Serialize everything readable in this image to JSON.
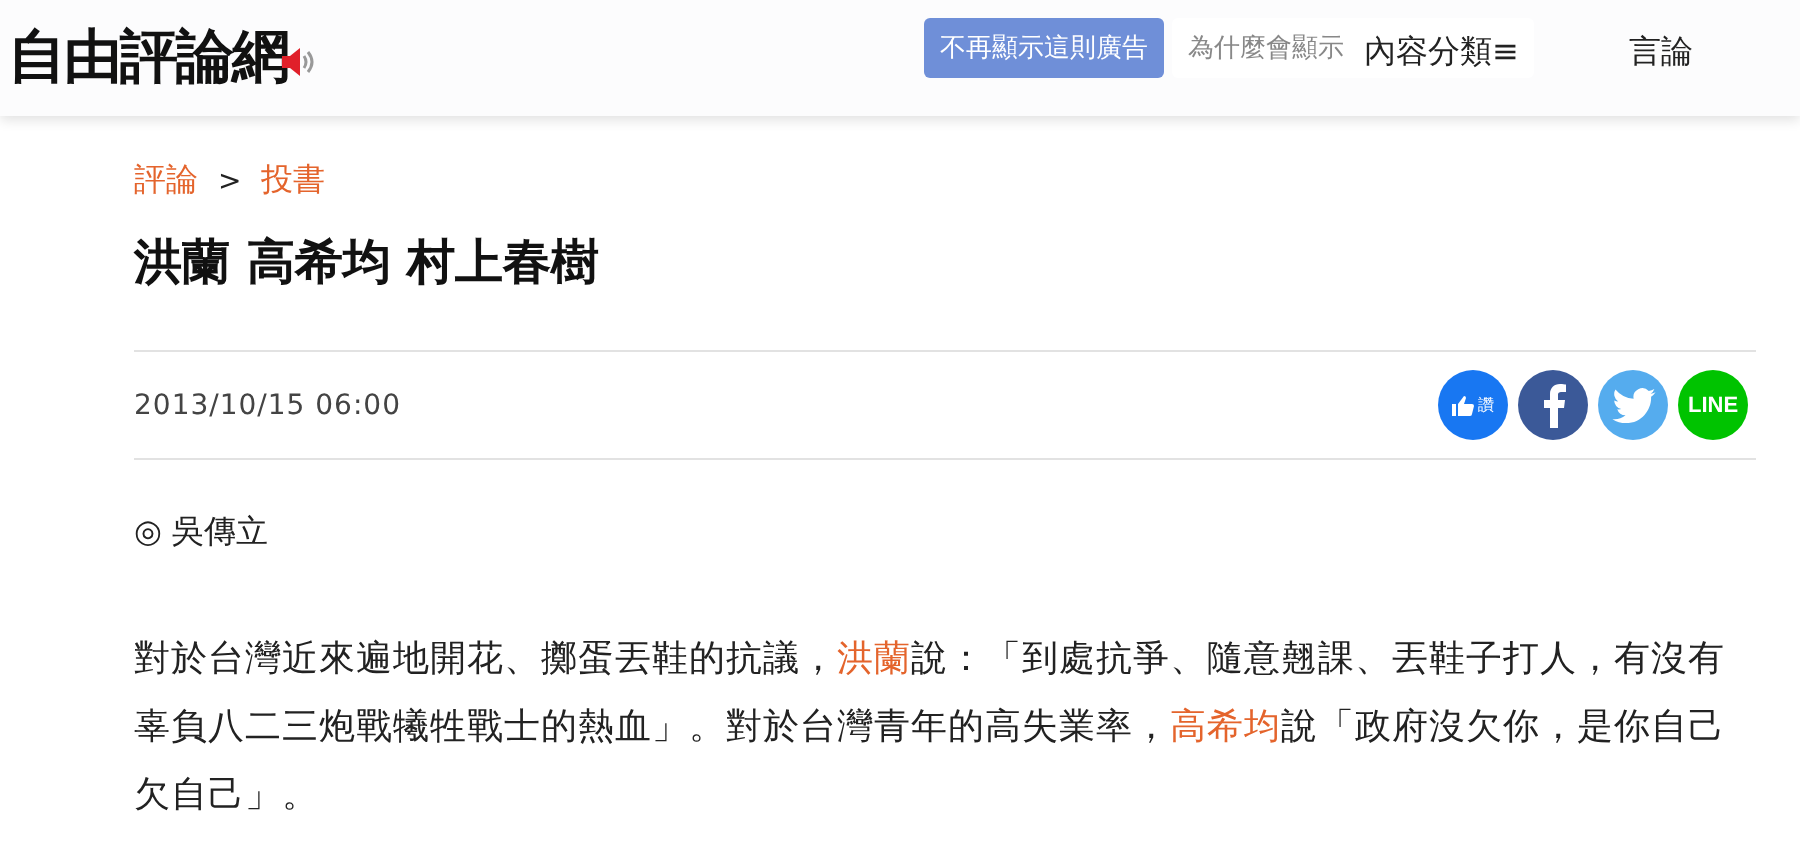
{
  "header": {
    "logo": "自由評論網",
    "ad_buttons": [
      "不再顯示這則廣告",
      "為什麼會顯示"
    ],
    "nav": [
      {
        "label": "內容分類",
        "icon": "≡"
      },
      {
        "label": "言論"
      }
    ]
  },
  "breadcrumb": [
    "評論",
    "投書"
  ],
  "breadcrumb_separator": ">",
  "title": "洪蘭 高希均 村上春樹",
  "date": "2013/10/15 06:00",
  "share_buttons": [
    {
      "kind": "like",
      "label": "讚"
    },
    {
      "kind": "facebook"
    },
    {
      "kind": "twitter"
    },
    {
      "kind": "line",
      "label": "LINE"
    }
  ],
  "author": "◎ 吳傳立",
  "paragraph": [
    {
      "kind": "plain",
      "text": "對於台灣近來遍地開花、擲蛋丟鞋的抗議，"
    },
    {
      "kind": "link",
      "text": "洪蘭"
    },
    {
      "kind": "plain",
      "text": "說：「到處抗爭、隨意翹課、丟鞋子打人，有沒有辜負八二三炮戰犧牲戰士的熱血」。對於台灣青年的高失業率，"
    },
    {
      "kind": "link",
      "text": "高希均"
    },
    {
      "kind": "plain",
      "text": "說「政府沒欠你，是你自己欠自己」。"
    }
  ]
}
